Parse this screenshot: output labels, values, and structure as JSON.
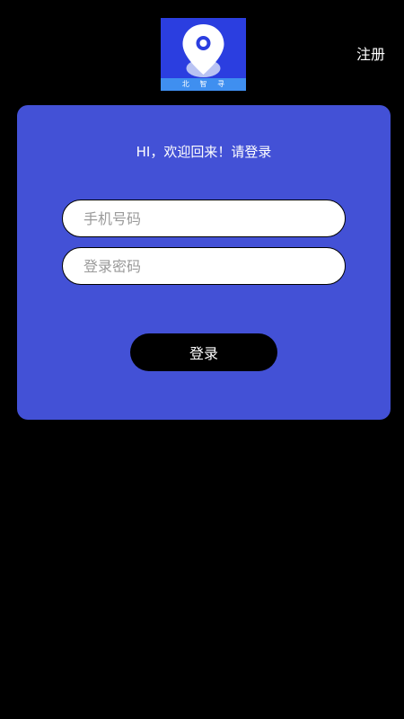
{
  "logo": {
    "caption_chars": [
      "北",
      "智",
      "寻"
    ],
    "bg_color": "#2b3ee0",
    "strip_color": "#3f8ff0",
    "icon": "location-pin-icon"
  },
  "header": {
    "register_label": "注册"
  },
  "card": {
    "bg_color": "#4351d6",
    "greeting": "HI，欢迎回来！请登录",
    "phone_placeholder": "手机号码",
    "phone_value": "",
    "password_placeholder": "登录密码",
    "password_value": "",
    "login_label": "登录"
  }
}
